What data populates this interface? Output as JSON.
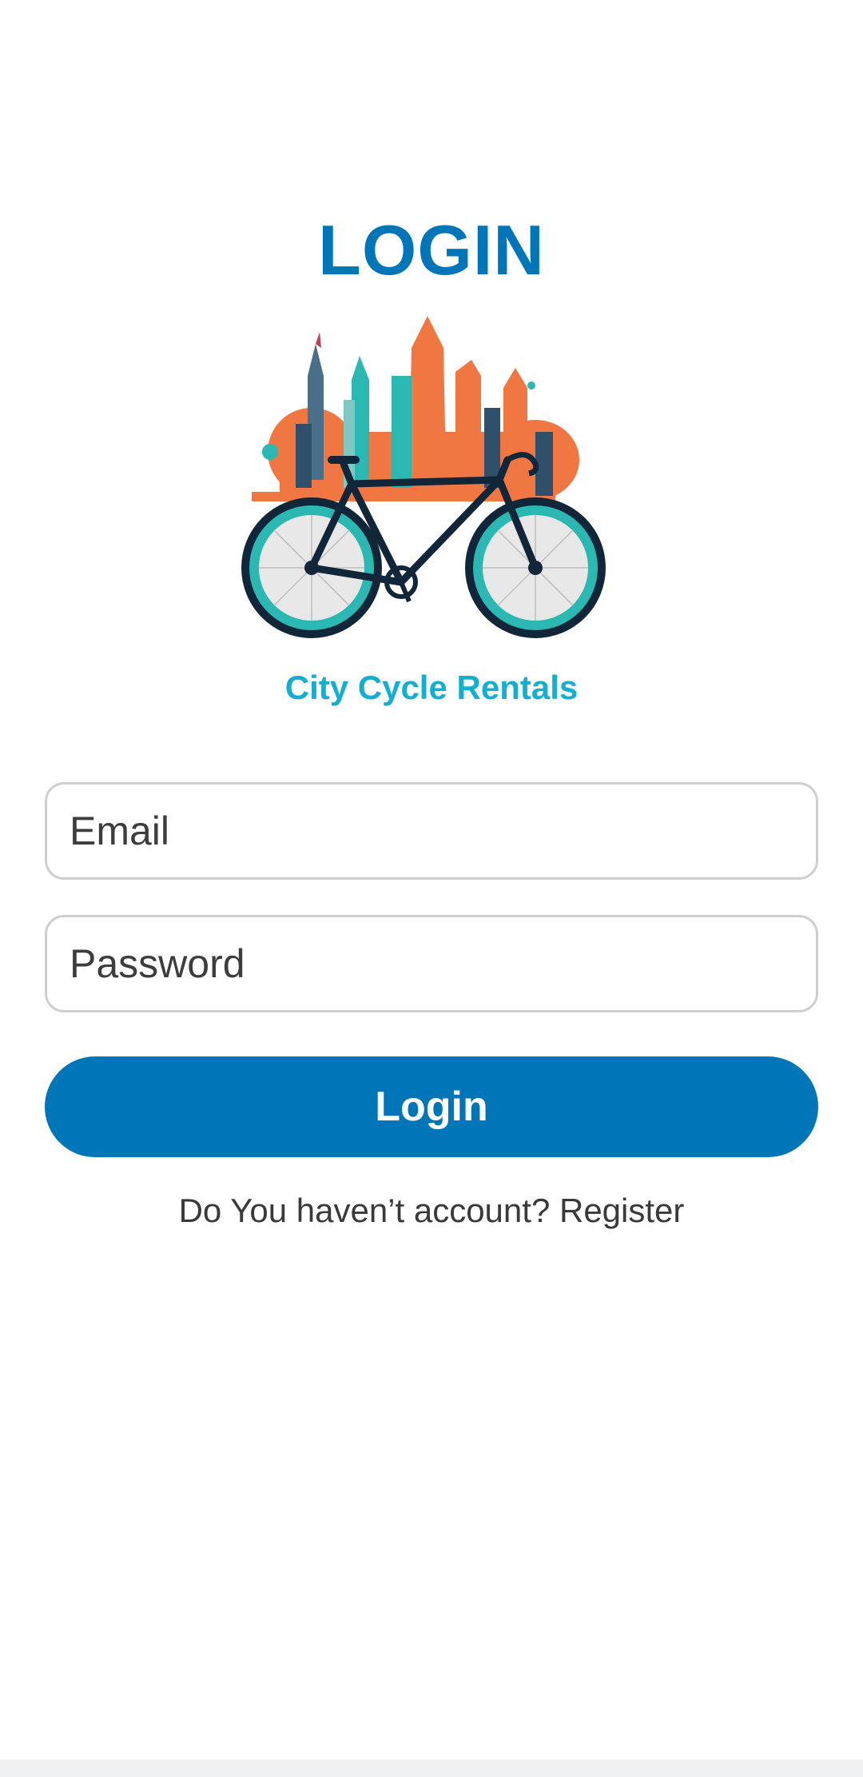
{
  "header": {
    "title": "LOGIN"
  },
  "logo": {
    "icon": "city-bicycle-logo",
    "brand_name": "City Cycle Rentals",
    "colors": {
      "orange": "#f07642",
      "teal": "#2bb8b3",
      "navy": "#12263a",
      "brand_text": "#12afd0"
    }
  },
  "form": {
    "email": {
      "placeholder": "Email",
      "value": ""
    },
    "password": {
      "placeholder": "Password",
      "value": ""
    },
    "login_button": "Login"
  },
  "register": {
    "prompt": "Do You haven’t account? ",
    "link": "Register"
  },
  "theme": {
    "primary": "#0075b8",
    "border": "#cfcfcf",
    "text": "#3d3d3d"
  }
}
